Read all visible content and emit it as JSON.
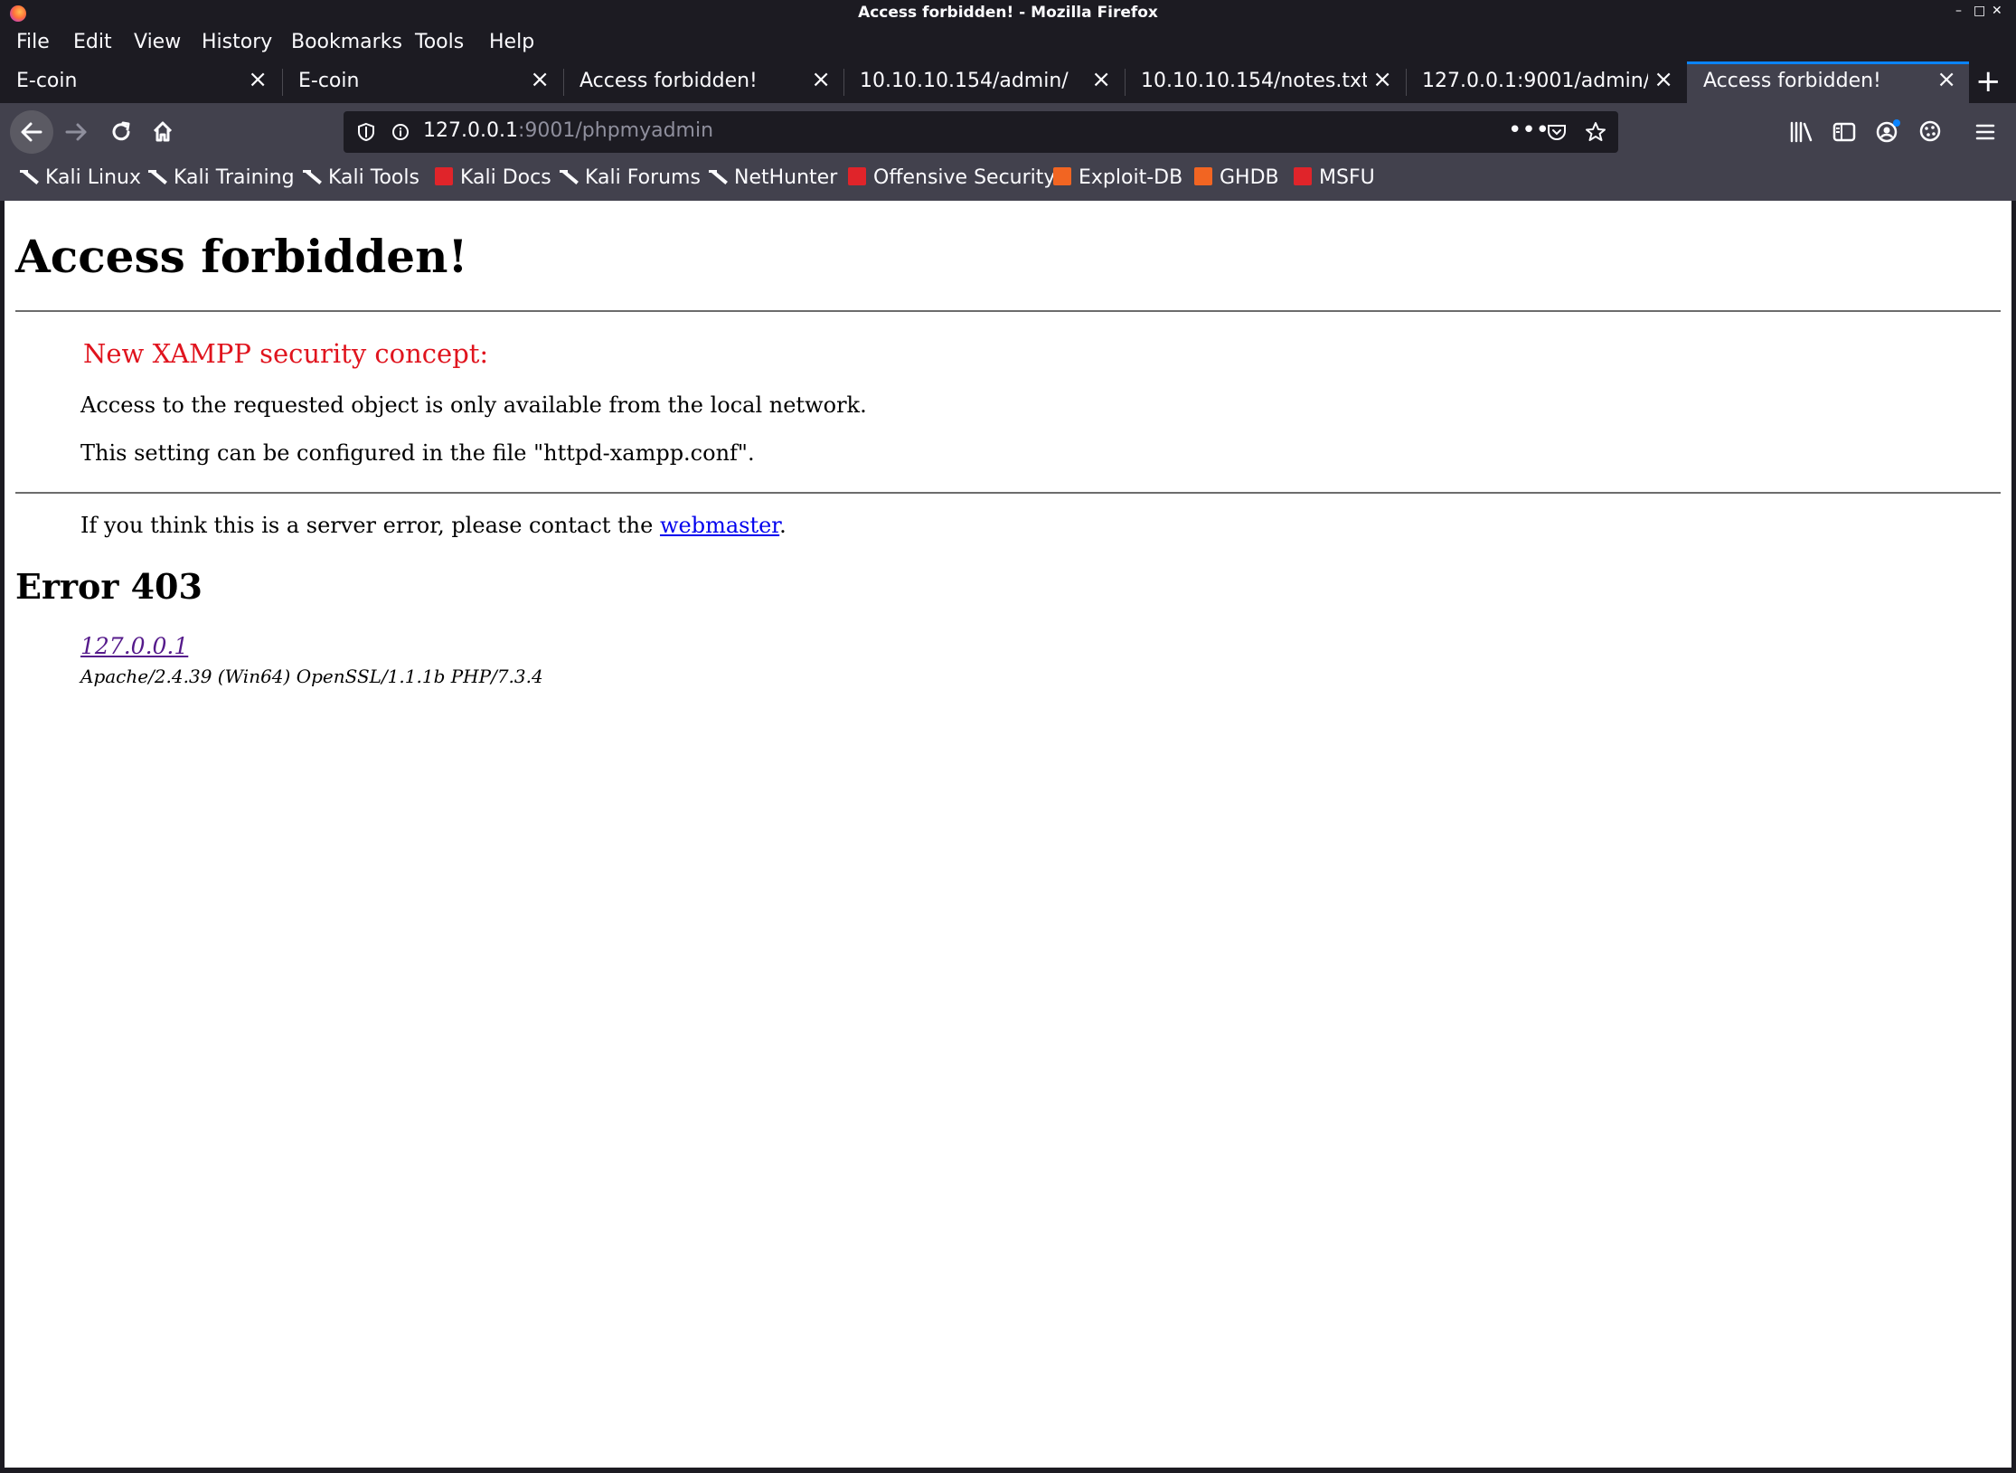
{
  "window": {
    "title": "Access forbidden! - Mozilla Firefox",
    "controls": [
      "–",
      "□",
      "✕"
    ]
  },
  "menu": [
    "File",
    "Edit",
    "View",
    "History",
    "Bookmarks",
    "Tools",
    "Help"
  ],
  "tabs": [
    {
      "label": "E-coin"
    },
    {
      "label": "E-coin"
    },
    {
      "label": "Access forbidden!"
    },
    {
      "label": "10.10.10.154/admin/"
    },
    {
      "label": "10.10.10.154/notes.txt"
    },
    {
      "label": "127.0.0.1:9001/admin/"
    },
    {
      "label": "Access forbidden!",
      "active": true
    }
  ],
  "urlbar": {
    "host": "127.0.0.1",
    "path": ":9001/phpmyadmin"
  },
  "bookmarks": [
    {
      "label": "Kali Linux",
      "icon": "kali-dragon-icon"
    },
    {
      "label": "Kali Training",
      "icon": "kali-dragon-icon"
    },
    {
      "label": "Kali Tools",
      "icon": "kali-dragon-icon"
    },
    {
      "label": "Kali Docs",
      "icon": "kali-docs-icon"
    },
    {
      "label": "Kali Forums",
      "icon": "kali-dragon-icon"
    },
    {
      "label": "NetHunter",
      "icon": "kali-dragon-icon"
    },
    {
      "label": "Offensive Security",
      "icon": "offsec-icon"
    },
    {
      "label": "Exploit-DB",
      "icon": "exploit-db-icon"
    },
    {
      "label": "GHDB",
      "icon": "exploit-db-icon"
    },
    {
      "label": "MSFU",
      "icon": "offsec-icon"
    }
  ],
  "page": {
    "heading": "Access forbidden!",
    "concept": "New XAMPP security concept:",
    "line1": "Access to the requested object is only available from the local network.",
    "line2": "This setting can be configured in the file \"httpd-xampp.conf\".",
    "contact_prefix": "If you think this is a server error, please contact the ",
    "contact_link": "webmaster",
    "contact_suffix": ".",
    "error_title": "Error 403",
    "host_link": "127.0.0.1",
    "server_signature": "Apache/2.4.39 (Win64) OpenSSL/1.1.1b PHP/7.3.4"
  }
}
